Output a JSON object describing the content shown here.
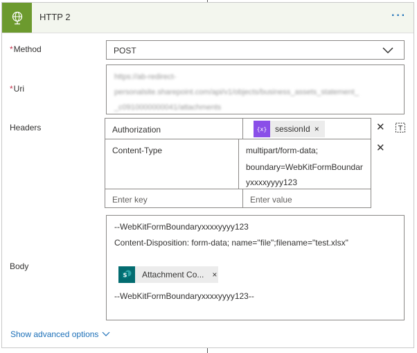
{
  "card": {
    "title": "HTTP 2",
    "more_label": "···",
    "icon": "globe-icon",
    "accent_color": "#6c9a2e"
  },
  "method": {
    "label": "Method",
    "required_mark": "*",
    "value": "POST",
    "icon": "chevron-down-icon"
  },
  "uri": {
    "label": "Uri",
    "required_mark": "*",
    "lines": [
      "https://ab-redirect-",
      "personalsite.sharepoint.com/api/v1/objects/business_assets_statement_",
      "_c0910000000041/attachments"
    ]
  },
  "headers": {
    "label": "Headers",
    "rows": [
      {
        "key": "Authorization",
        "token": "sessionId",
        "token_icon": "variable-icon",
        "token_color": "#8a4fe8"
      },
      {
        "key": "Content-Type",
        "value_lines": [
          "multipart/form-data;",
          "boundary=WebKitFormBoundar",
          "yxxxxyyyy123"
        ]
      }
    ],
    "key_placeholder": "Enter key",
    "value_placeholder": "Enter value",
    "remove_label": "✕",
    "switch_icon": "text-mode-icon"
  },
  "body": {
    "label": "Body",
    "line1": "--WebKitFormBoundaryxxxxyyyy123",
    "line2": "Content-Disposition:  form-data; name=\"file\";filename=\"test.xlsx\"",
    "token": "Attachment Co...",
    "token_icon": "sharepoint-icon",
    "token_color": "#036c70",
    "line3": "--WebKitFormBoundaryxxxxyyyy123--"
  },
  "advanced": {
    "label": "Show advanced options",
    "icon": "chevron-down-icon"
  },
  "token_close": "×"
}
